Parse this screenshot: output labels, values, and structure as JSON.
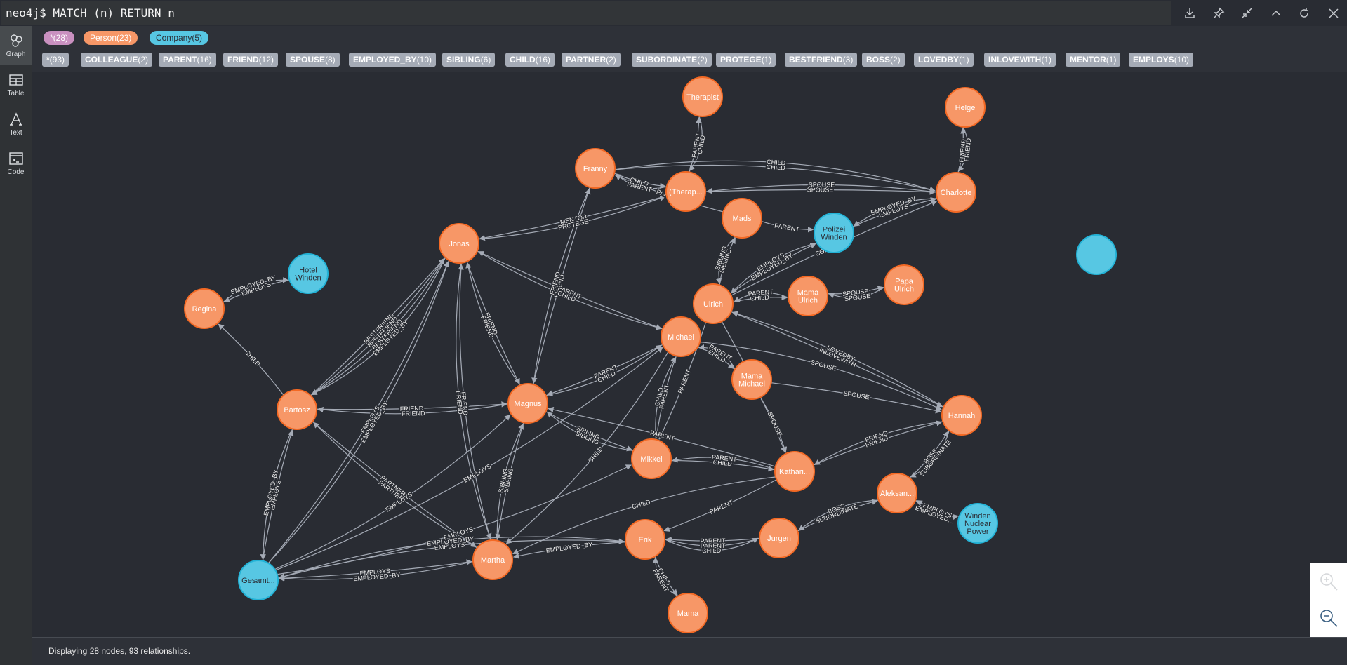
{
  "query": "neo4j$ MATCH (n) RETURN n",
  "top_icons": [
    "download-icon",
    "pin-icon",
    "collapse-icon",
    "chevron-up-icon",
    "rerun-icon",
    "close-icon"
  ],
  "sidebar": {
    "items": [
      {
        "label": "Graph",
        "icon": "graph-icon",
        "active": true
      },
      {
        "label": "Table",
        "icon": "table-icon",
        "active": false
      },
      {
        "label": "Text",
        "icon": "text-icon",
        "active": false
      },
      {
        "label": "Code",
        "icon": "code-icon",
        "active": false
      }
    ]
  },
  "node_labels": [
    {
      "name": "*",
      "count": "(28)",
      "color": "#c990c0",
      "text_color": "#ffffff"
    },
    {
      "name": "Person",
      "count": "(23)",
      "color": "#f79767",
      "text_color": "#ffffff"
    },
    {
      "name": "Company",
      "count": "(5)",
      "color": "#57c7e3",
      "text_color": "#2a2c34"
    }
  ],
  "relationship_types": [
    {
      "name": "*",
      "count": "(93)"
    },
    {
      "name": "COLLEAGUE",
      "count": "(2)"
    },
    {
      "name": "PARENT",
      "count": "(16)"
    },
    {
      "name": "FRIEND",
      "count": "(12)"
    },
    {
      "name": "SPOUSE",
      "count": "(8)"
    },
    {
      "name": "EMPLOYED_BY",
      "count": "(10)"
    },
    {
      "name": "SIBLING",
      "count": "(6)"
    },
    {
      "name": "CHILD",
      "count": "(16)"
    },
    {
      "name": "PARTNER",
      "count": "(2)"
    },
    {
      "name": "SUBORDINATE",
      "count": "(2)"
    },
    {
      "name": "PROTEGE",
      "count": "(1)"
    },
    {
      "name": "BESTFRIEND",
      "count": "(3)"
    },
    {
      "name": "BOSS",
      "count": "(2)"
    },
    {
      "name": "LOVEDBY",
      "count": "(1)"
    },
    {
      "name": "INLOVEWITH",
      "count": "(1)"
    },
    {
      "name": "MENTOR",
      "count": "(1)"
    },
    {
      "name": "EMPLOYS",
      "count": "(10)"
    }
  ],
  "colors": {
    "person_fill": "#f79767",
    "person_stroke": "#f36924",
    "company_fill": "#57c7e3",
    "company_stroke": "#23b3d7",
    "edge": "#a5abb6"
  },
  "graph": {
    "nodes": [
      {
        "id": "therapist",
        "label": "Therapist",
        "type": "Person"
      },
      {
        "id": "helge",
        "label": "Helge",
        "type": "Person"
      },
      {
        "id": "franny",
        "label": "Franny",
        "type": "Person"
      },
      {
        "id": "therap2",
        "label": "(Therap...",
        "type": "Person"
      },
      {
        "id": "charlotte",
        "label": "Charlotte",
        "type": "Person"
      },
      {
        "id": "mads",
        "label": "Mads",
        "type": "Person"
      },
      {
        "id": "polizei",
        "label": "Polizei\nWinden",
        "type": "Company"
      },
      {
        "id": "jonas",
        "label": "Jonas",
        "type": "Person"
      },
      {
        "id": "hotel",
        "label": "Hotel\nWinden",
        "type": "Company"
      },
      {
        "id": "regina",
        "label": "Regina",
        "type": "Person"
      },
      {
        "id": "unnamed",
        "label": "",
        "type": "Company"
      },
      {
        "id": "ulrich",
        "label": "Ulrich",
        "type": "Person"
      },
      {
        "id": "mamaulrich",
        "label": "Mama\nUlrich",
        "type": "Person"
      },
      {
        "id": "papaulrich",
        "label": "Papa\nUlrich",
        "type": "Person"
      },
      {
        "id": "michael",
        "label": "Michael",
        "type": "Person"
      },
      {
        "id": "mamamichael",
        "label": "Mama\nMichael",
        "type": "Person"
      },
      {
        "id": "bartosz",
        "label": "Bartosz",
        "type": "Person"
      },
      {
        "id": "magnus",
        "label": "Magnus",
        "type": "Person"
      },
      {
        "id": "hannah",
        "label": "Hannah",
        "type": "Person"
      },
      {
        "id": "mikkel",
        "label": "Mikkel",
        "type": "Person"
      },
      {
        "id": "katharina",
        "label": "Kathari...",
        "type": "Person"
      },
      {
        "id": "aleksander",
        "label": "Aleksan...",
        "type": "Person"
      },
      {
        "id": "wnp",
        "label": "Winden\nNuclear\nPower",
        "type": "Company"
      },
      {
        "id": "jurgen",
        "label": "Jurgen",
        "type": "Person"
      },
      {
        "id": "erik",
        "label": "Erik",
        "type": "Person"
      },
      {
        "id": "martha",
        "label": "Martha",
        "type": "Person"
      },
      {
        "id": "gesamt",
        "label": "Gesamt...",
        "type": "Company"
      },
      {
        "id": "mama",
        "label": "Mama",
        "type": "Person"
      }
    ],
    "edges": [
      {
        "from": "therap2",
        "to": "therapist",
        "label": "PARENT"
      },
      {
        "from": "therapist",
        "to": "therap2",
        "label": "CHILD"
      },
      {
        "from": "charlotte",
        "to": "helge",
        "label": "FRIEND"
      },
      {
        "from": "helge",
        "to": "charlotte",
        "label": "FRIEND"
      },
      {
        "from": "franny",
        "to": "charlotte",
        "label": "CHILD"
      },
      {
        "from": "franny",
        "to": "therap2",
        "label": "CHILD"
      },
      {
        "from": "therap2",
        "to": "franny",
        "label": "PARENT"
      },
      {
        "from": "therap2",
        "to": "charlotte",
        "label": "SPOUSE"
      },
      {
        "from": "franny",
        "to": "charlotte",
        "label": "CHILD"
      },
      {
        "from": "charlotte",
        "to": "therap2",
        "label": "SPOUSE"
      },
      {
        "from": "mads",
        "to": "franny",
        "label": "PARENT"
      },
      {
        "from": "polizei",
        "to": "charlotte",
        "label": "EMPLOYS"
      },
      {
        "from": "charlotte",
        "to": "polizei",
        "label": "EMPLOYED_BY"
      },
      {
        "from": "therap2",
        "to": "jonas",
        "label": "MENTOR"
      },
      {
        "from": "jonas",
        "to": "therap2",
        "label": "PROTEGE"
      },
      {
        "from": "hotel",
        "to": "regina",
        "label": "EMPLOYS"
      },
      {
        "from": "regina",
        "to": "hotel",
        "label": "EMPLOYED_BY"
      },
      {
        "from": "bartosz",
        "to": "regina",
        "label": "CHILD"
      },
      {
        "from": "bartosz",
        "to": "jonas",
        "label": "BESTFRIEND"
      },
      {
        "from": "bartosz",
        "to": "jonas",
        "label": "BESTFRIEND"
      },
      {
        "from": "jonas",
        "to": "bartosz",
        "label": "BESTFRIEND"
      },
      {
        "from": "jonas",
        "to": "bartosz",
        "label": "EMPLOYED_BY"
      },
      {
        "from": "bartosz",
        "to": "magnus",
        "label": "FRIEND"
      },
      {
        "from": "magnus",
        "to": "bartosz",
        "label": "FRIEND"
      },
      {
        "from": "jonas",
        "to": "magnus",
        "label": "FRIEND"
      },
      {
        "from": "magnus",
        "to": "jonas",
        "label": "FRIEND"
      },
      {
        "from": "martha",
        "to": "jonas",
        "label": "FRIEND"
      },
      {
        "from": "jonas",
        "to": "martha",
        "label": "FRIEND"
      },
      {
        "from": "magnus",
        "to": "franny",
        "label": "FRIEND"
      },
      {
        "from": "franny",
        "to": "magnus",
        "label": "FRIEND"
      },
      {
        "from": "michael",
        "to": "jonas",
        "label": "PARENT"
      },
      {
        "from": "jonas",
        "to": "michael",
        "label": "CHILD"
      },
      {
        "from": "ulrich",
        "to": "mads",
        "label": "SIBLING"
      },
      {
        "from": "mads",
        "to": "ulrich",
        "label": "SIBLING"
      },
      {
        "from": "ulrich",
        "to": "polizei",
        "label": "EMPLOYED_BY"
      },
      {
        "from": "polizei",
        "to": "ulrich",
        "label": "EMPLOYS"
      },
      {
        "from": "ulrich",
        "to": "charlotte",
        "label": "COLLEAGUE"
      },
      {
        "from": "ulrich",
        "to": "mamaulrich",
        "label": "CHILD"
      },
      {
        "from": "mamaulrich",
        "to": "ulrich",
        "label": "PARENT"
      },
      {
        "from": "mamaulrich",
        "to": "papaulrich",
        "label": "SPOUSE"
      },
      {
        "from": "papaulrich",
        "to": "mamaulrich",
        "label": "SPOUSE"
      },
      {
        "from": "michael",
        "to": "magnus",
        "label": "PARENT"
      },
      {
        "from": "magnus",
        "to": "michael",
        "label": "CHILD"
      },
      {
        "from": "michael",
        "to": "mamamichael",
        "label": "CHILD"
      },
      {
        "from": "mamamichael",
        "to": "michael",
        "label": "PARENT"
      },
      {
        "from": "michael",
        "to": "mikkel",
        "label": "PARENT"
      },
      {
        "from": "mikkel",
        "to": "michael",
        "label": "CHILD"
      },
      {
        "from": "ulrich",
        "to": "mikkel",
        "label": "PARENT"
      },
      {
        "from": "ulrich",
        "to": "hannah",
        "label": "INLOVEWITH"
      },
      {
        "from": "hannah",
        "to": "ulrich",
        "label": "LOVEDBY"
      },
      {
        "from": "michael",
        "to": "hannah",
        "label": "SPOUSE"
      },
      {
        "from": "mamamichael",
        "to": "hannah",
        "label": "SPOUSE"
      },
      {
        "from": "mamamichael",
        "to": "katharina",
        "label": "SPOUSE"
      },
      {
        "from": "ulrich",
        "to": "katharina",
        "label": "SPOUSE"
      },
      {
        "from": "katharina",
        "to": "hannah",
        "label": "FRIEND"
      },
      {
        "from": "hannah",
        "to": "katharina",
        "label": "FRIEND"
      },
      {
        "from": "magnus",
        "to": "mikkel",
        "label": "SIBLING"
      },
      {
        "from": "mikkel",
        "to": "magnus",
        "label": "SIBLING"
      },
      {
        "from": "katharina",
        "to": "magnus",
        "label": "PARENT"
      },
      {
        "from": "mikkel",
        "to": "katharina",
        "label": "CHILD"
      },
      {
        "from": "katharina",
        "to": "mikkel",
        "label": "PARENT"
      },
      {
        "from": "aleksander",
        "to": "hannah",
        "label": "BOSS"
      },
      {
        "from": "hannah",
        "to": "aleksander",
        "label": "SUBORDINATE"
      },
      {
        "from": "jurgen",
        "to": "aleksander",
        "label": "SUBORDINATE"
      },
      {
        "from": "aleksander",
        "to": "jurgen",
        "label": "BOSS"
      },
      {
        "from": "wnp",
        "to": "aleksander",
        "label": "EMPLOYS"
      },
      {
        "from": "aleksander",
        "to": "wnp",
        "label": "EMPLOYED..."
      },
      {
        "from": "jurgen",
        "to": "erik",
        "label": "PARENT"
      },
      {
        "from": "jurgen",
        "to": "erik",
        "label": "PARENT"
      },
      {
        "from": "erik",
        "to": "jurgen",
        "label": "CHILD"
      },
      {
        "from": "erik",
        "to": "mama",
        "label": "CHILD"
      },
      {
        "from": "mama",
        "to": "erik",
        "label": "PARENT"
      },
      {
        "from": "katharina",
        "to": "erik",
        "label": "PARENT"
      },
      {
        "from": "magnus",
        "to": "martha",
        "label": "SIBLING"
      },
      {
        "from": "martha",
        "to": "magnus",
        "label": "SIBLING"
      },
      {
        "from": "gesamt",
        "to": "martha",
        "label": "EMPLOYS"
      },
      {
        "from": "martha",
        "to": "gesamt",
        "label": "EMPLOYED_BY"
      },
      {
        "from": "gesamt",
        "to": "erik",
        "label": "EMPLOYS"
      },
      {
        "from": "erik",
        "to": "gesamt",
        "label": "EMPLOYED_BY"
      },
      {
        "from": "erik",
        "to": "martha",
        "label": "EMPLOYED_BY"
      },
      {
        "from": "gesamt",
        "to": "bartosz",
        "label": "EMPLOYS"
      },
      {
        "from": "bartosz",
        "to": "gesamt",
        "label": "EMPLOYED_BY"
      },
      {
        "from": "gesamt",
        "to": "jonas",
        "label": "EMPLOYS"
      },
      {
        "from": "gesamt",
        "to": "magnus",
        "label": "EMPLOYS"
      },
      {
        "from": "gesamt",
        "to": "mikkel",
        "label": "EMPLOYS"
      },
      {
        "from": "bartosz",
        "to": "martha",
        "label": "PARTNER"
      },
      {
        "from": "martha",
        "to": "bartosz",
        "label": "PARTNER"
      },
      {
        "from": "katharina",
        "to": "martha",
        "label": "CHILD"
      },
      {
        "from": "michael",
        "to": "martha",
        "label": "CHILD"
      },
      {
        "from": "gesamt",
        "to": "jonas",
        "label": "EMPLOYED_BY"
      },
      {
        "from": "mads",
        "to": "polizei",
        "label": "PARENT"
      },
      {
        "from": "gesamt",
        "to": "michael",
        "label": "EMPLOYS"
      }
    ]
  },
  "zoom_controls": {
    "zoom_in": "zoom-in-icon",
    "zoom_out": "zoom-out-icon"
  },
  "footer": {
    "status": "Displaying 28 nodes, 93 relationships."
  }
}
